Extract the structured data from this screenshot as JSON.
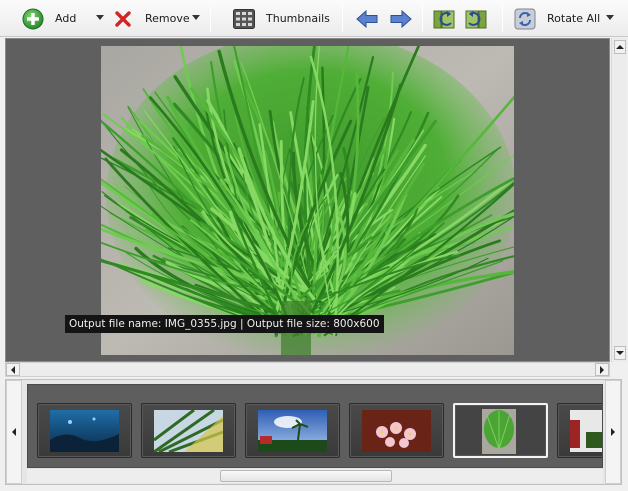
{
  "toolbar": {
    "add_label": "Add",
    "remove_label": "Remove",
    "thumbnails_label": "Thumbnails",
    "rotate_all_label": "Rotate All"
  },
  "viewer": {
    "caption": "Output file name: IMG_0355.jpg | Output file size: 800x600"
  },
  "filmstrip": {
    "selected_index": 4,
    "thumbnails": [
      {
        "subject": "underwater"
      },
      {
        "subject": "palm-leaf"
      },
      {
        "subject": "palm-trees-sky"
      },
      {
        "subject": "pink-flowers"
      },
      {
        "subject": "green-plant"
      },
      {
        "subject": "partial"
      }
    ]
  },
  "colors": {
    "add_green": "#3aa03a",
    "remove_red": "#d42a2a",
    "arrow_blue": "#4f78c8",
    "viewer_bg": "#5f5f5f"
  }
}
